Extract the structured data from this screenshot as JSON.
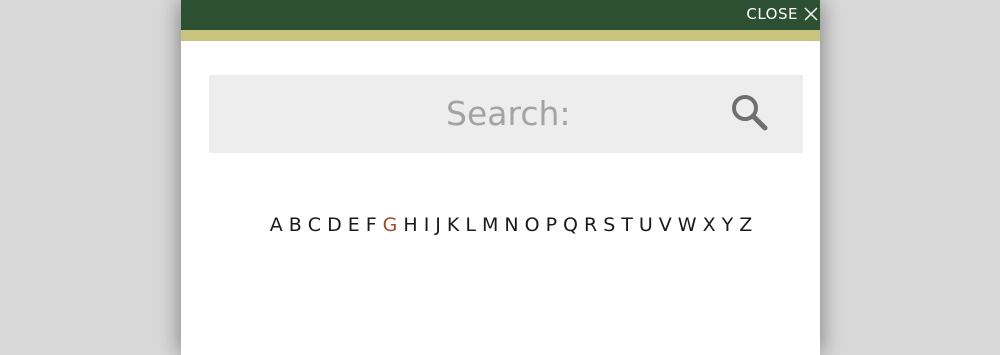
{
  "colors": {
    "header_bar": "#2d5032",
    "accent_bar": "#c8c47e",
    "active_letter": "#a0492f",
    "search_bg": "#ededed"
  },
  "header": {
    "close_label": "CLOSE",
    "close_icon": "close-icon"
  },
  "search": {
    "placeholder": "Search:",
    "icon": "search-icon"
  },
  "alphabet": {
    "active": "G",
    "letters": [
      "A",
      "B",
      "C",
      "D",
      "E",
      "F",
      "G",
      "H",
      "I",
      "J",
      "K",
      "L",
      "M",
      "N",
      "O",
      "P",
      "Q",
      "R",
      "S",
      "T",
      "U",
      "V",
      "W",
      "X",
      "Y",
      "Z"
    ]
  }
}
